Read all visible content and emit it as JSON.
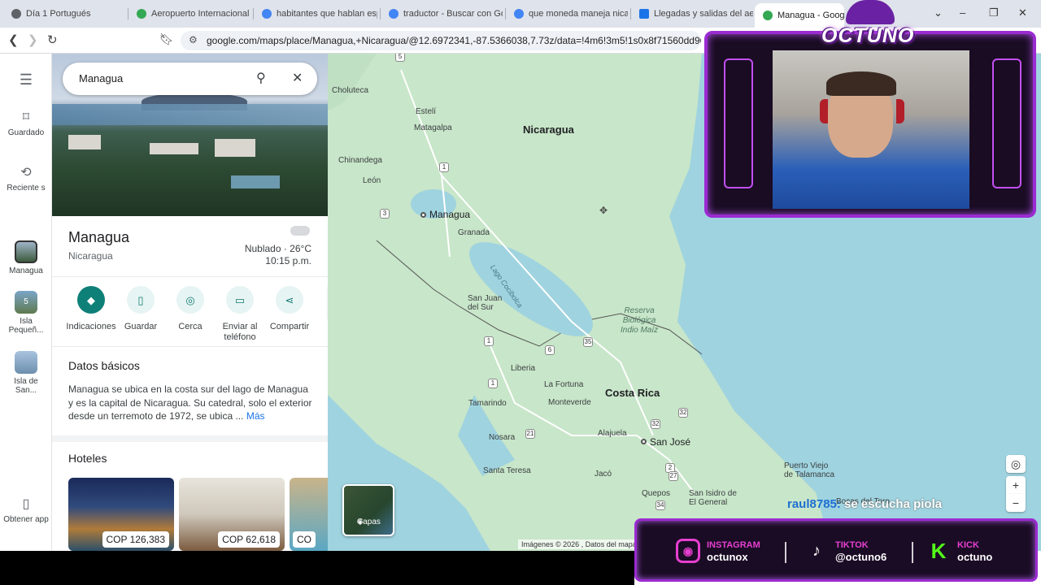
{
  "browser": {
    "tabs": [
      {
        "title": "Día 1 Portugués",
        "favicon_color": "#5f6368"
      },
      {
        "title": "Aeropuerto Internacional",
        "favicon_color": "#34a853"
      },
      {
        "title": "habitantes que hablan esp",
        "favicon_color": "#4285f4"
      },
      {
        "title": "traductor - Buscar con Go",
        "favicon_color": "#4285f4"
      },
      {
        "title": "que moneda maneja nica",
        "favicon_color": "#4285f4"
      },
      {
        "title": "Llegadas y salidas del aer",
        "favicon_color": "#1a73e8"
      },
      {
        "title": "Managua - Googl",
        "favicon_color": "#34a853"
      }
    ],
    "url": "google.com/maps/place/Managua,+Nicaragua/@12.6972341,-87.5366038,7.73z/data=!4m6!3m5!1s0x8f71560dd907880"
  },
  "rail": {
    "menu_icon": "menu-icon",
    "saved_label": "Guardado",
    "recent_label": "Reciente s",
    "items": [
      {
        "label": "Managua"
      },
      {
        "label": "Isla Pequeñ...",
        "badge": "5"
      },
      {
        "label": "Isla de San..."
      }
    ],
    "get_app_label": "Obtener app"
  },
  "panel": {
    "search_value": "Managua",
    "place_title": "Managua",
    "place_subtitle": "Nicaragua",
    "weather_line": "Nublado · 26°C",
    "time_line": "10:15 p.m.",
    "actions": [
      {
        "label": "Indicaciones",
        "icon": "directions-icon"
      },
      {
        "label": "Guardar",
        "icon": "bookmark-icon"
      },
      {
        "label": "Cerca",
        "icon": "nearby-icon"
      },
      {
        "label": "Enviar al teléfono",
        "icon": "phone-icon"
      },
      {
        "label": "Compartir",
        "icon": "share-icon"
      }
    ],
    "basics_heading": "Datos básicos",
    "description": "Managua se ubica en la costa sur del lago de Managua y es la capital de Nicaragua. Su catedral, solo el exterior desde un terremoto de 1972, se ubica ...",
    "more_label": "Más",
    "hotels_heading": "Hoteles",
    "hotels": [
      {
        "price": "COP 126,383"
      },
      {
        "price": "COP 62,618"
      },
      {
        "price": "CO"
      }
    ]
  },
  "map": {
    "countries": [
      "Nicaragua",
      "Costa Rica"
    ],
    "cities": [
      "Managua",
      "San José"
    ],
    "places": [
      "Choluteca",
      "Estelí",
      "Matagalpa",
      "Chinandega",
      "León",
      "Granada",
      "San Juan del Sur",
      "Liberia",
      "La Fortuna",
      "Tamarindo",
      "Monteverde",
      "Alajuela",
      "Nosara",
      "Santa Teresa",
      "Jacó",
      "Quepos",
      "San Isidro de El General",
      "Puerto Viejo de Talamanca",
      "Bocas del Toro"
    ],
    "lake_label": "Lago Cocibolca",
    "reserve_label": "Reserva Biológica Indio Maíz",
    "routes": [
      "5",
      "1",
      "3",
      "1",
      "6",
      "35",
      "1",
      "21",
      "32",
      "32",
      "27",
      "2",
      "34"
    ],
    "layers_label": "Capas",
    "attribution": "Imágenes © 2026 , Datos del mapa"
  },
  "stream": {
    "brand": "OCTUNO",
    "chat_user": "raul8785:",
    "chat_message": "se escucha piola",
    "socials": [
      {
        "network": "INSTAGRAM",
        "handle": "octunox",
        "color": "#e63fd0"
      },
      {
        "network": "TIKTOK",
        "handle": "@octuno6",
        "color": "#e63fd0"
      },
      {
        "network": "KICK",
        "handle": "octuno",
        "color": "#53fc18"
      }
    ]
  }
}
